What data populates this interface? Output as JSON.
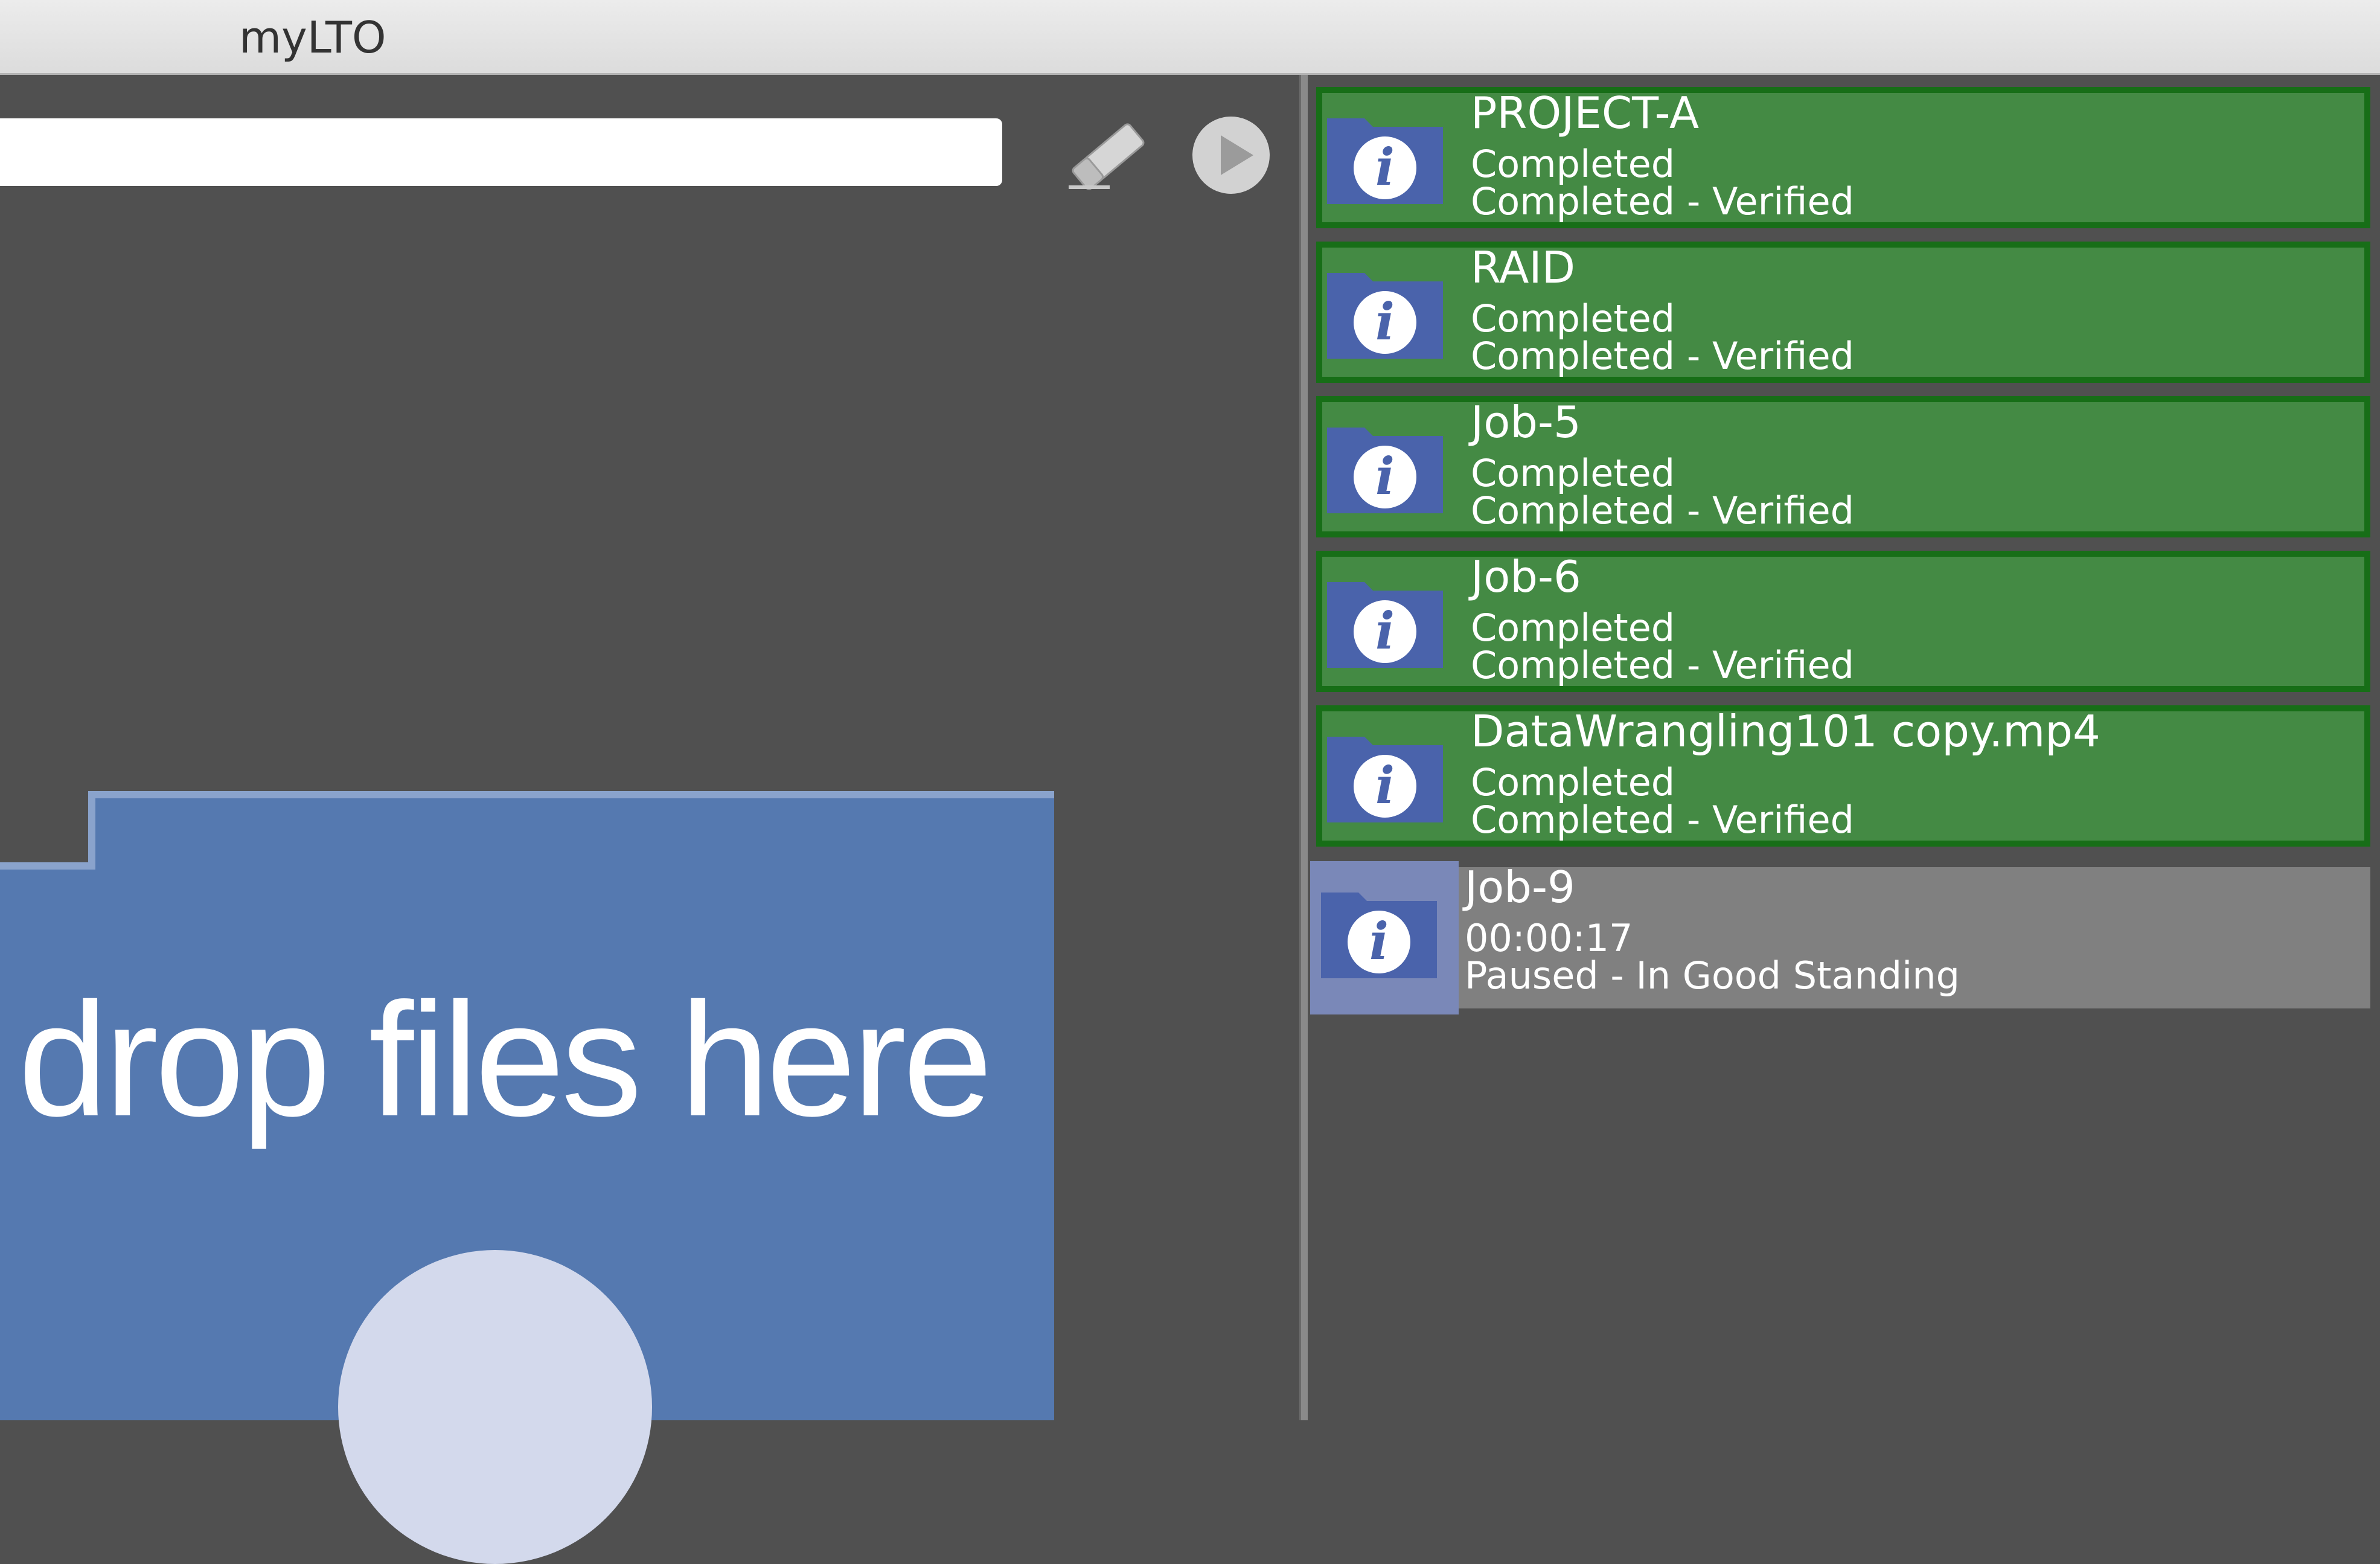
{
  "app": {
    "title": "myLTO"
  },
  "toolbar": {
    "path_value": "",
    "path_placeholder": "",
    "clear_icon": "eraser-icon",
    "start_icon": "play-icon"
  },
  "dropzone": {
    "label": "drop files here",
    "icon": "folder-icon"
  },
  "colors": {
    "completed_fill": "#448a44",
    "completed_border": "#176e17",
    "paused_fill": "#808080",
    "progress_fill": "#7a88b8",
    "folder_blue": "#4a63ab",
    "dropzone_blue": "#5579b0"
  },
  "jobs": [
    {
      "name": "PROJECT-A",
      "status": "Completed",
      "detail": "Completed - Verified",
      "state": "completed"
    },
    {
      "name": "RAID",
      "status": "Completed",
      "detail": "Completed - Verified",
      "state": "completed"
    },
    {
      "name": "Job-5",
      "status": "Completed",
      "detail": "Completed - Verified",
      "state": "completed"
    },
    {
      "name": "Job-6",
      "status": "Completed",
      "detail": "Completed - Verified",
      "state": "completed"
    },
    {
      "name": "DataWrangling101 copy.mp4",
      "status": "Completed",
      "detail": "Completed - Verified",
      "state": "completed"
    },
    {
      "name": "Job-9",
      "status": "00:00:17",
      "detail": "Paused - In Good Standing",
      "state": "paused",
      "progress": 0.135
    }
  ]
}
